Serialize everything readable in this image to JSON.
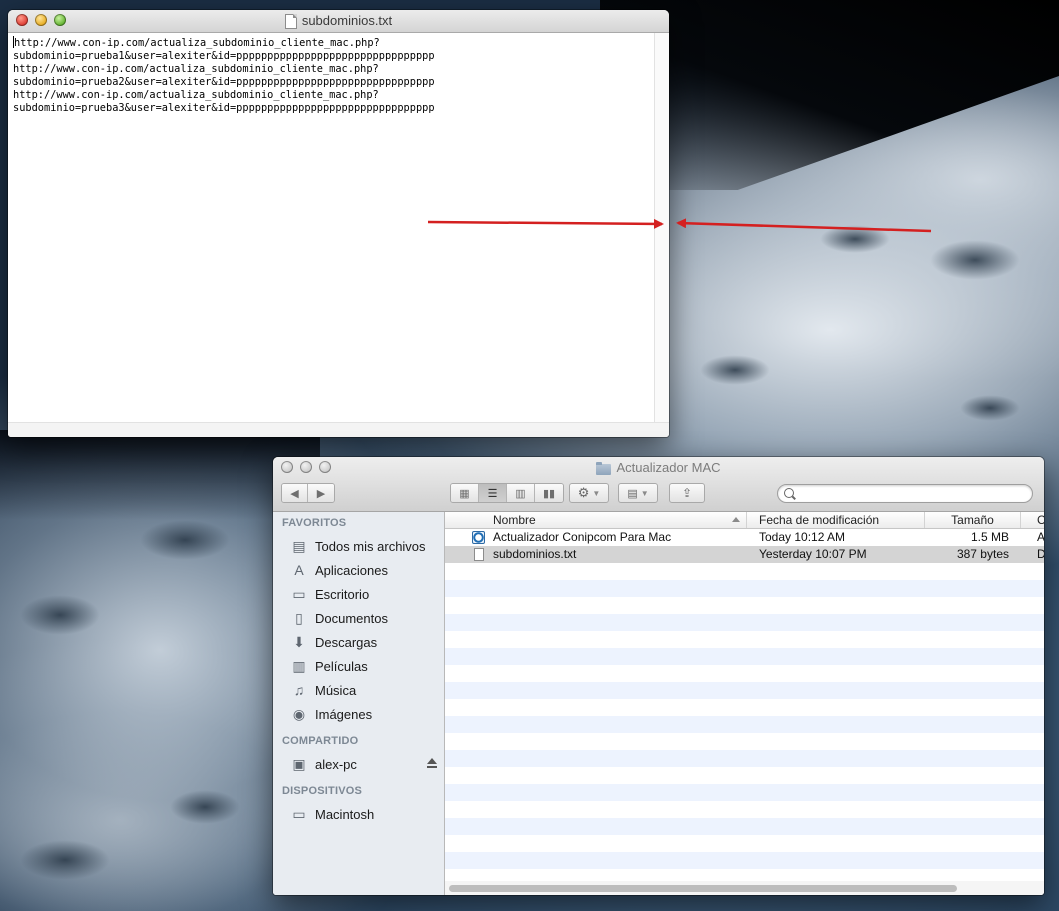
{
  "textedit": {
    "title": "subdominios.txt",
    "lines": [
      "http://www.con-ip.com/actualiza_subdominio_cliente_mac.php?",
      "subdominio=prueba1&user=alexiter&id=pppppppppppppppppppppppppppppppp",
      "http://www.con-ip.com/actualiza_subdominio_cliente_mac.php?",
      "subdominio=prueba2&user=alexiter&id=pppppppppppppppppppppppppppppppp",
      "http://www.con-ip.com/actualiza_subdominio_cliente_mac.php?",
      "subdominio=prueba3&user=alexiter&id=pppppppppppppppppppppppppppppppp"
    ]
  },
  "finder": {
    "title": "Actualizador MAC",
    "toolbar": {
      "back_icon": "back-arrow-icon",
      "forward_icon": "forward-arrow-icon",
      "view_icons": [
        "icon-view",
        "list-view",
        "column-view",
        "coverflow-view"
      ],
      "active_view": "list-view",
      "action_icon": "gear-icon",
      "arrange_icon": "arrange-icon",
      "share_icon": "share-icon",
      "search_placeholder": ""
    },
    "sidebar": {
      "favoritos_label": "FAVORITOS",
      "favoritos": [
        {
          "label": "Todos mis archivos",
          "icon": "all-files-icon"
        },
        {
          "label": "Aplicaciones",
          "icon": "applications-icon"
        },
        {
          "label": "Escritorio",
          "icon": "desktop-icon"
        },
        {
          "label": "Documentos",
          "icon": "documents-icon"
        },
        {
          "label": "Descargas",
          "icon": "downloads-icon"
        },
        {
          "label": "Películas",
          "icon": "movies-icon"
        },
        {
          "label": "Música",
          "icon": "music-icon"
        },
        {
          "label": "Imágenes",
          "icon": "pictures-icon"
        }
      ],
      "compartido_label": "COMPARTIDO",
      "compartido": [
        {
          "label": "alex-pc",
          "icon": "network-computer-icon"
        }
      ],
      "dispositivos_label": "DISPOSITIVOS",
      "dispositivos": [
        {
          "label": "Macintosh",
          "icon": "hard-disk-icon"
        }
      ]
    },
    "columns": {
      "name": "Nombre",
      "date": "Fecha de modificación",
      "size": "Tamaño",
      "kind": "C"
    },
    "files": [
      {
        "name": "Actualizador Conipcom  Para Mac",
        "date": "Today 10:12 AM",
        "size": "1.5 MB",
        "kind": "A",
        "icon": "app-icon",
        "selected": false
      },
      {
        "name": "subdominios.txt",
        "date": "Yesterday 10:07 PM",
        "size": "387 bytes",
        "kind": "D",
        "icon": "text-file-icon",
        "selected": true
      }
    ]
  },
  "colors": {
    "arrow": "#d42020",
    "selection": "#d4d4d4",
    "stripe": "#edf3fe"
  }
}
